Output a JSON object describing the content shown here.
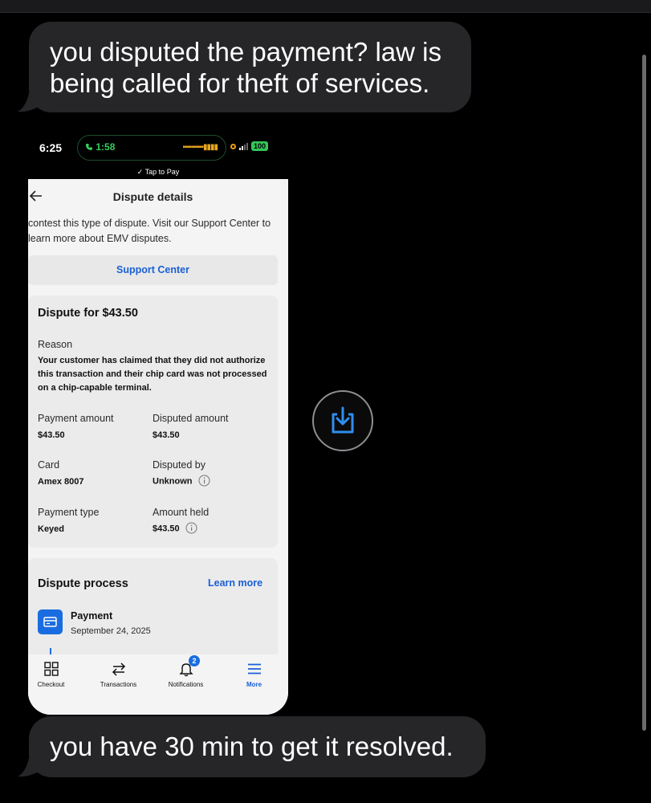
{
  "messages": [
    {
      "text": "you disputed the payment? law is being called for theft of services."
    },
    {
      "text": "you have 30 min to get it resolved."
    }
  ],
  "phone": {
    "status_bar": {
      "time": "6:25",
      "call_timer": "1:58",
      "battery": "100",
      "tap_to_pay": "Tap to Pay"
    },
    "header": {
      "title": "Dispute details"
    },
    "intro_text": "contest this type of dispute. Visit our Support Center to learn more about EMV disputes.",
    "support_button": "Support Center",
    "dispute_card": {
      "title": "Dispute for $43.50",
      "reason_label": "Reason",
      "reason_text": "Your customer has claimed that they did not authorize this transaction and their chip card was not processed on a chip-capable terminal.",
      "fields": {
        "payment_amount": {
          "label": "Payment amount",
          "value": "$43.50"
        },
        "disputed_amount": {
          "label": "Disputed amount",
          "value": "$43.50"
        },
        "card": {
          "label": "Card",
          "value": "Amex 8007"
        },
        "disputed_by": {
          "label": "Disputed by",
          "value": "Unknown"
        },
        "payment_type": {
          "label": "Payment type",
          "value": "Keyed"
        },
        "amount_held": {
          "label": "Amount held",
          "value": "$43.50"
        }
      }
    },
    "process_card": {
      "title": "Dispute process",
      "learn_more": "Learn more",
      "step": {
        "title": "Payment",
        "date": "September 24, 2025"
      }
    },
    "tabbar": {
      "tabs": [
        {
          "label": "Checkout",
          "icon": "grid-icon"
        },
        {
          "label": "Transactions",
          "icon": "arrows-icon"
        },
        {
          "label": "Notifications",
          "icon": "bell-icon",
          "badge": "2"
        },
        {
          "label": "More",
          "icon": "menu-icon",
          "active": true
        }
      ]
    }
  },
  "colors": {
    "background": "#000000",
    "bubble": "#262629",
    "accent_blue": "#1a5fd6",
    "save_icon_blue": "#2f8ff0"
  }
}
